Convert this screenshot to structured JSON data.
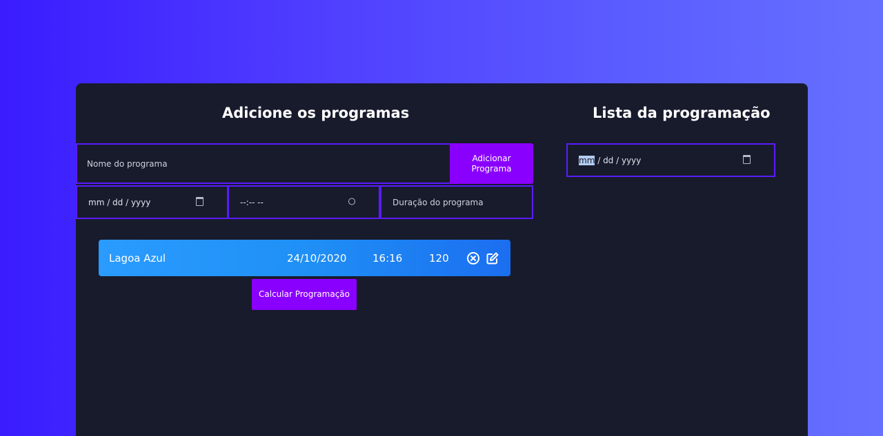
{
  "left_panel": {
    "title": "Adicione os programas",
    "name_placeholder": "Nome do programa",
    "add_button_line1": "Adicionar",
    "add_button_line2": "Programa",
    "date_placeholder": "mm / dd / yyyy",
    "time_placeholder": "--:-- --",
    "duration_placeholder": "Duração do programa",
    "calc_button": "Calcular Programação"
  },
  "right_panel": {
    "title": "Lista da programação",
    "date_mm": "mm",
    "date_rest": " / dd / yyyy"
  },
  "programs": [
    {
      "name": "Lagoa Azul",
      "date": "24/10/2020",
      "time": "16:16",
      "duration": "120"
    }
  ],
  "colors": {
    "accent": "#8a00ff",
    "border": "#5a1cff",
    "card_bg": "#181b2c",
    "item_gradient_start": "#2a9bff",
    "item_gradient_end": "#1b6ef0"
  },
  "icons": {
    "delete": "close-circle-icon",
    "edit": "edit-icon",
    "calendar": "calendar-icon",
    "clock": "clock-icon"
  }
}
